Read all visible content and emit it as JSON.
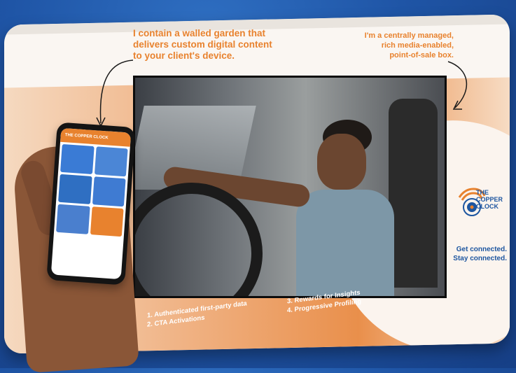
{
  "callouts": {
    "left": [
      "I contain a walled garden that",
      "delivers custom digital content",
      "to your client's device."
    ],
    "right": [
      "I'm a centrally managed,",
      "rich media-enabled,",
      "point-of-sale box."
    ]
  },
  "features": {
    "group_a": [
      "1. Authenticated first-party data",
      "2. CTA Activations"
    ],
    "group_b": [
      "3. Rewards for Insights",
      "4. Progressive Profiling"
    ]
  },
  "brand": {
    "name_lines": [
      "THE",
      "COPPER",
      "CLOCK"
    ],
    "tagline": [
      "Get connected.",
      "Stay connected."
    ],
    "color_orange": "#e8822e",
    "color_blue": "#1e56a0"
  },
  "phone": {
    "header": "THE COPPER CLOCK",
    "tiles": [
      {
        "color": "#3a7bd5"
      },
      {
        "color": "#4b86d6"
      },
      {
        "color": "#2f6fc2"
      },
      {
        "color": "#3f7bd2"
      },
      {
        "color": "#4a7fce"
      },
      {
        "color": "#e8822e"
      }
    ]
  }
}
